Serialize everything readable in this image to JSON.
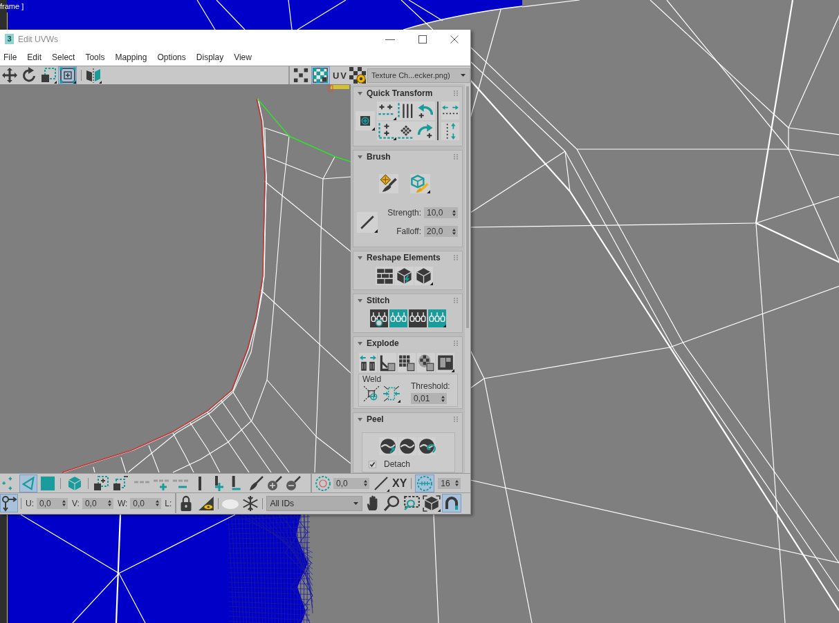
{
  "viewport": {
    "label": "frame ]"
  },
  "window": {
    "icon_label": "3",
    "title": "Edit UVWs"
  },
  "menu": [
    "File",
    "Edit",
    "Select",
    "Tools",
    "Mapping",
    "Options",
    "Display",
    "View"
  ],
  "toolbar": {
    "transform_tools": [
      {
        "kind": "move",
        "selected": false
      },
      {
        "kind": "rotate",
        "selected": false
      },
      {
        "kind": "scale",
        "selected": false
      },
      {
        "kind": "freeform",
        "selected": true
      }
    ],
    "tiles_toggle": {
      "on": true
    },
    "uv_label": "UV",
    "texture_dropdown": "Texture Ch...ecker.png)"
  },
  "rollouts": [
    {
      "kind": "quick_transform",
      "title": "Quick Transform",
      "expanded": true
    },
    {
      "kind": "brush",
      "title": "Brush",
      "expanded": true,
      "fields": [
        {
          "label": "Strength:",
          "value": "10,0"
        },
        {
          "label": "Falloff:",
          "value": "20,0"
        }
      ]
    },
    {
      "kind": "reshape",
      "title": "Reshape Elements",
      "expanded": true
    },
    {
      "kind": "stitch",
      "title": "Stitch",
      "expanded": true
    },
    {
      "kind": "explode",
      "title": "Explode",
      "expanded": true,
      "weld": {
        "label": "Weld",
        "threshold_label": "Threshold:",
        "threshold": "0,01"
      }
    },
    {
      "kind": "peel",
      "title": "Peel",
      "expanded": true,
      "detach": {
        "label": "Detach",
        "checked": true
      }
    }
  ],
  "bottom_toolbar": {
    "selection_modes": [
      {
        "kind": "vertex",
        "selected": false
      },
      {
        "kind": "edge",
        "selected": true
      },
      {
        "kind": "polygon",
        "selected": false
      }
    ],
    "soft_selection_value": "0,0",
    "axis_label": "XY",
    "snap": {
      "on": true,
      "value": "16"
    }
  },
  "status_toolbar": {
    "mode_toggle": {
      "on": true
    },
    "coords": [
      {
        "label": "U:",
        "value": "0,0"
      },
      {
        "label": "V:",
        "value": "0,0"
      },
      {
        "label": "W:",
        "value": "0,0"
      }
    ],
    "extra_label": "L:",
    "id_filter": "All IDs",
    "magnet": {
      "on": true
    }
  }
}
